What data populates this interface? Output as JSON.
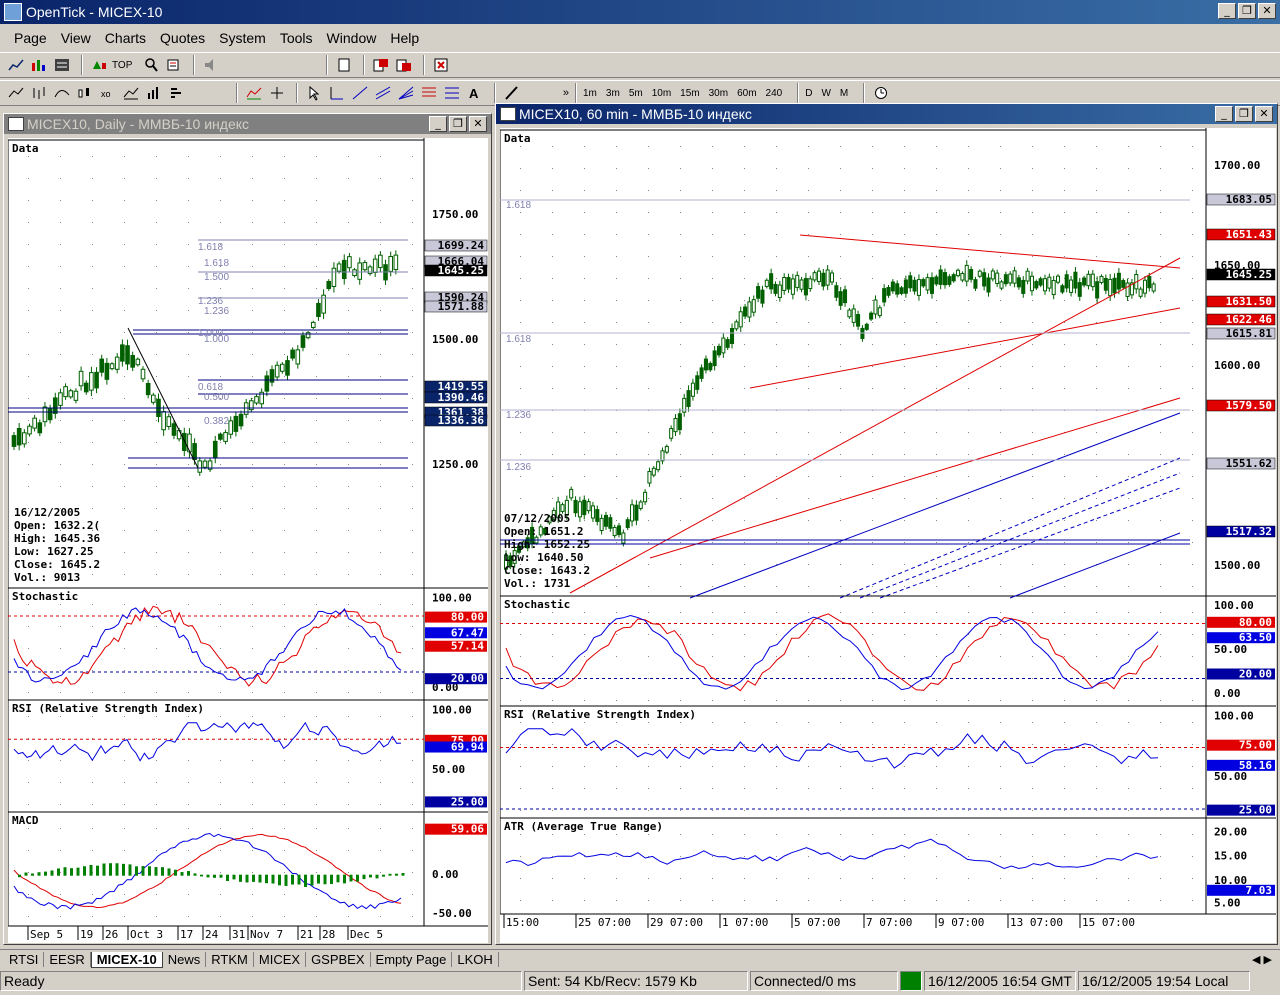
{
  "app": {
    "title": "OpenTick - MICEX-10"
  },
  "window_buttons": {
    "minimize": "_",
    "restore": "❐",
    "close": "✕"
  },
  "menu": [
    "Page",
    "View",
    "Charts",
    "Quotes",
    "System",
    "Tools",
    "Window",
    "Help"
  ],
  "toolbar1": {
    "top_label": "TOP"
  },
  "toolbar2": {
    "intervals": [
      "1m",
      "3m",
      "5m",
      "10m",
      "15m",
      "30m",
      "60m",
      "240"
    ],
    "periods": [
      "D",
      "W",
      "M"
    ],
    "more": "»"
  },
  "left_chart": {
    "title": "MICEX10, Daily - ММВБ-10 индекс",
    "panels": [
      "Data",
      "Stochastic",
      "RSI (Relative Strength Index)",
      "MACD"
    ],
    "price_axis": [
      "1750.00",
      "1500.00",
      "1250.00"
    ],
    "price_tags": [
      {
        "v": "1699.24",
        "c": "#c8c8d8",
        "t": "#000"
      },
      {
        "v": "1666.04",
        "c": "#c8c8d8",
        "t": "#000"
      },
      {
        "v": "1645.25",
        "c": "#000",
        "t": "#fff"
      },
      {
        "v": "1590.24",
        "c": "#c8c8d8",
        "t": "#000"
      },
      {
        "v": "1571.88",
        "c": "#c8c8d8",
        "t": "#000"
      },
      {
        "v": "1419.55",
        "c": "#0a246a",
        "t": "#fff"
      },
      {
        "v": "1390.46",
        "c": "#0a246a",
        "t": "#fff"
      },
      {
        "v": "1361.38",
        "c": "#0a246a",
        "t": "#fff"
      },
      {
        "v": "1336.36",
        "c": "#0a246a",
        "t": "#fff"
      }
    ],
    "fib_labels": [
      "1.618",
      "1.618",
      "1.500",
      "1.236",
      "1.236",
      "1.000",
      "1.000",
      "0.618",
      "0.500",
      "0.382"
    ],
    "info": {
      "date": "16/12/2005",
      "open": "Open: 1632.2(",
      "high": "High: 1645.36",
      "low": "Low: 1627.25",
      "close": "Close: 1645.2",
      "vol": "Vol.: 9013"
    },
    "stoch_axis": [
      "100.00",
      "0.00"
    ],
    "stoch_tags": [
      {
        "v": "80.00",
        "c": "#e00000"
      },
      {
        "v": "67.47",
        "c": "#0000e0"
      },
      {
        "v": "57.14",
        "c": "#e00000"
      },
      {
        "v": "20.00",
        "c": "#0000a0"
      }
    ],
    "rsi_axis": [
      "100.00",
      "50.00"
    ],
    "rsi_tags": [
      {
        "v": "75.00",
        "c": "#e00000"
      },
      {
        "v": "69.94",
        "c": "#0000e0"
      },
      {
        "v": "25.00",
        "c": "#0000a0"
      }
    ],
    "macd_axis": [
      "0.00",
      "-50.00"
    ],
    "macd_tags": [
      {
        "v": "59.06",
        "c": "#e00000"
      }
    ],
    "x_labels": [
      "Sep 5",
      "19",
      "26",
      "Oct 3",
      "17",
      "24",
      "31",
      "Nov 7",
      "21",
      "28",
      "Dec 5"
    ]
  },
  "right_chart": {
    "title": "MICEX10, 60 min - ММВБ-10 индекс",
    "panels": [
      "Data",
      "Stochastic",
      "RSI (Relative Strength Index)",
      "ATR (Average True Range)"
    ],
    "price_axis": [
      "1700.00",
      "1650.00",
      "1600.00",
      "1550.00",
      "1500.00"
    ],
    "price_tags": [
      {
        "v": "1683.05",
        "c": "#c8c8d8",
        "t": "#000"
      },
      {
        "v": "1651.43",
        "c": "#e00000",
        "t": "#fff"
      },
      {
        "v": "1645.25",
        "c": "#000",
        "t": "#fff"
      },
      {
        "v": "1631.50",
        "c": "#e00000",
        "t": "#fff"
      },
      {
        "v": "1622.46",
        "c": "#e00000",
        "t": "#fff"
      },
      {
        "v": "1615.81",
        "c": "#c8c8d8",
        "t": "#000"
      },
      {
        "v": "1579.50",
        "c": "#e00000",
        "t": "#fff"
      },
      {
        "v": "1551.62",
        "c": "#c8c8d8",
        "t": "#000"
      },
      {
        "v": "1517.32",
        "c": "#0000a0",
        "t": "#fff"
      }
    ],
    "fib_labels": [
      "1.618",
      "1.618",
      "1.236",
      "1.236"
    ],
    "info": {
      "date": "07/12/2005",
      "open": "Open: 1651.2",
      "high": "High: 1652.25",
      "low": "Low: 1640.50",
      "close": "Close: 1643.2",
      "vol": "Vol.: 1731"
    },
    "stoch_axis": [
      "100.00",
      "50.00",
      "0.00"
    ],
    "stoch_tags": [
      {
        "v": "80.00",
        "c": "#e00000"
      },
      {
        "v": "63.50",
        "c": "#0000e0"
      },
      {
        "v": "20.00",
        "c": "#0000a0"
      }
    ],
    "rsi_axis": [
      "100.00",
      "50.00",
      "0.00"
    ],
    "rsi_tags": [
      {
        "v": "75.00",
        "c": "#e00000"
      },
      {
        "v": "58.16",
        "c": "#0000e0"
      },
      {
        "v": "25.00",
        "c": "#0000a0"
      }
    ],
    "atr_axis": [
      "20.00",
      "15.00",
      "10.00",
      "5.00"
    ],
    "atr_tags": [
      {
        "v": "7.03",
        "c": "#0000e0"
      }
    ],
    "x_labels": [
      "15:00",
      "25 07:00",
      "29 07:00",
      "1 07:00",
      "5 07:00",
      "7 07:00",
      "9 07:00",
      "13 07:00",
      "15 07:00"
    ]
  },
  "tabs": [
    "RTSI",
    "EESR",
    "MICEX-10",
    "News",
    "RTKM",
    "MICEX",
    "GSPBEX",
    "Empty Page",
    "LKOH"
  ],
  "active_tab": "MICEX-10",
  "status": {
    "ready": "Ready",
    "traffic": "Sent: 54 Kb/Recv: 1579 Kb",
    "connection": "Connected/0 ms",
    "gmt": "16/12/2005 16:54 GMT",
    "local": "16/12/2005 19:54 Local"
  }
}
